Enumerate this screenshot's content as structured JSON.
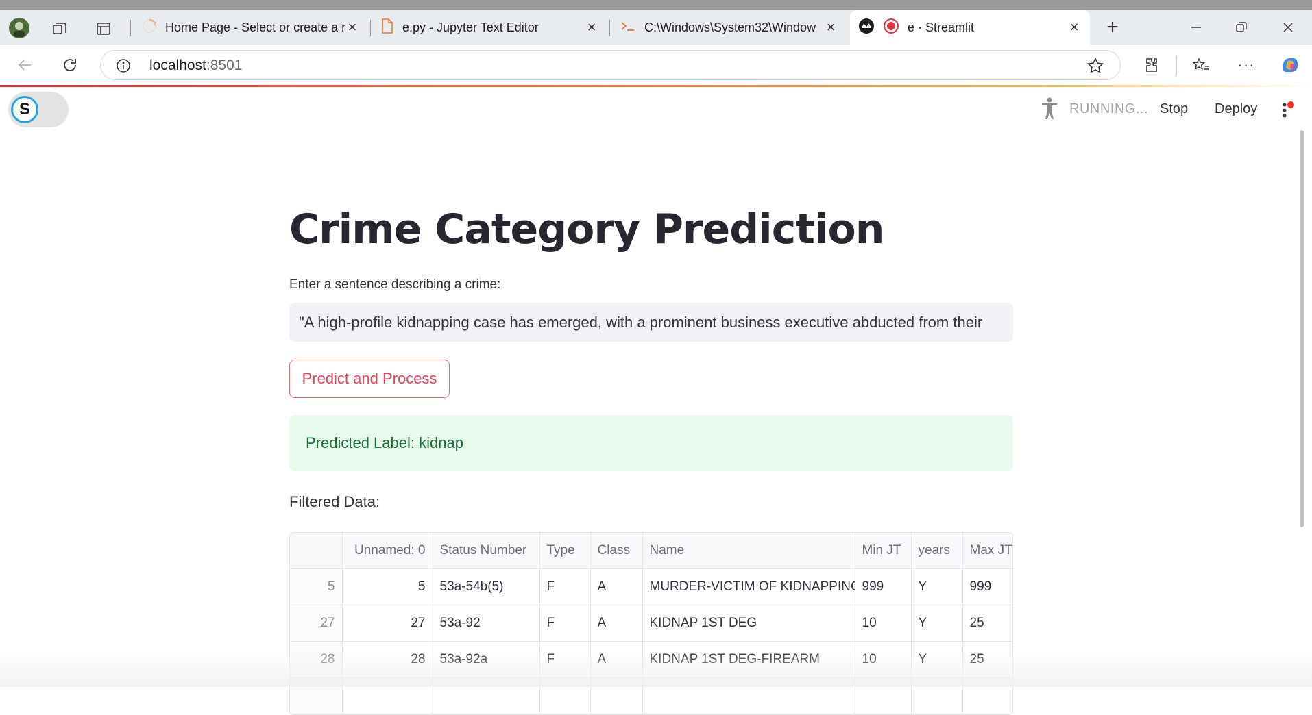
{
  "browser": {
    "tabs": [
      {
        "title": "Home Page - Select or create a r",
        "icon": "loading-spinner-icon"
      },
      {
        "title": "e.py - Jupyter Text Editor",
        "icon": "file-icon"
      },
      {
        "title": "C:\\Windows\\System32\\Window",
        "icon": "terminal-icon"
      },
      {
        "title": "e · Streamlit",
        "icon": "streamlit-icon",
        "active": true
      }
    ],
    "address": {
      "host": "localhost",
      "port": ":8501"
    }
  },
  "app": {
    "status": "RUNNING...",
    "stop_label": "Stop",
    "deploy_label": "Deploy",
    "toggle_letter": "S",
    "title": "Crime Category Prediction",
    "input_label": "Enter a sentence describing a crime:",
    "input_value": "\"A high-profile kidnapping case has emerged, with a prominent business executive abducted from their",
    "button_label": "Predict and Process",
    "success_text": "Predicted Label: kidnap",
    "filtered_label": "Filtered Data:",
    "table": {
      "headers": [
        "",
        "Unnamed: 0",
        "Status Number",
        "Type",
        "Class",
        "Name",
        "Min JT",
        "years",
        "Max JT"
      ],
      "rows": [
        [
          "5",
          "5",
          "53a-54b(5)",
          "F",
          "A",
          "MURDER-VICTIM OF KIDNAPPING",
          "999",
          "Y",
          "999"
        ],
        [
          "27",
          "27",
          "53a-92",
          "F",
          "A",
          "KIDNAP 1ST DEG",
          "10",
          "Y",
          "25"
        ],
        [
          "28",
          "28",
          "53a-92a",
          "F",
          "A",
          "KIDNAP 1ST DEG-FIREARM",
          "10",
          "Y",
          "25"
        ]
      ]
    }
  },
  "colors": {
    "accent": "#ff4b4b",
    "success_bg": "#e8f9ee",
    "success_text": "#177233"
  }
}
